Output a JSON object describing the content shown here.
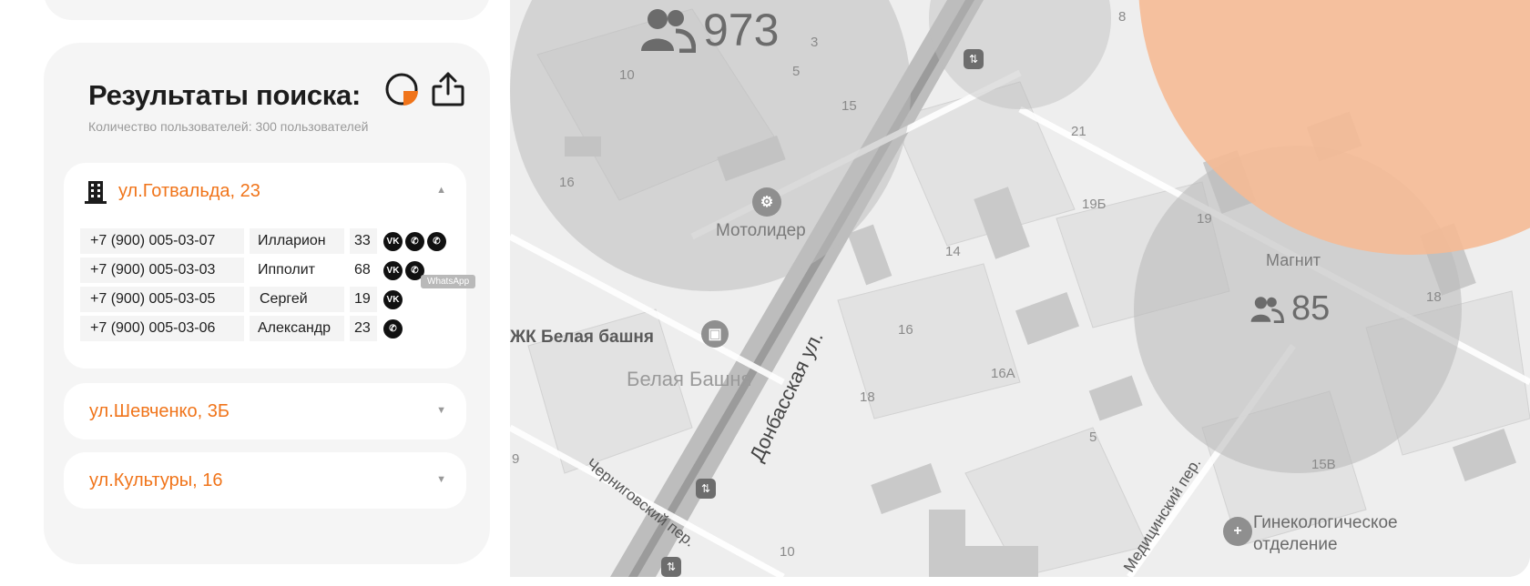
{
  "panel": {
    "title": "Результаты поиска:",
    "users_count": "Количество пользователей: 300 пользователей",
    "pie_icon": "pie-chart-icon",
    "share_icon": "share-icon"
  },
  "addresses": [
    {
      "title": "ул.Готвальда, 23",
      "expanded": true,
      "icon": "building-icon",
      "rows": [
        {
          "phone": "+7 (900) 005-03-07",
          "name": "Илларион",
          "age": "33",
          "socials": [
            "vk",
            "whatsapp",
            "whatsapp"
          ]
        },
        {
          "phone": "+7 (900) 005-03-03",
          "name": "Ипполит",
          "age": "68",
          "socials": [
            "vk",
            "whatsapp"
          ]
        },
        {
          "phone": "+7 (900) 005-03-05",
          "name": "Сергей",
          "age": "19",
          "socials": [
            "vk"
          ]
        },
        {
          "phone": "+7 (900) 005-03-06",
          "name": "Александр",
          "age": "23",
          "socials": [
            "whatsapp"
          ]
        }
      ]
    },
    {
      "title": "ул.Шевченко, 3Б",
      "expanded": false
    },
    {
      "title": "ул.Культуры, 16",
      "expanded": false
    }
  ],
  "tooltip": "WhatsApp",
  "social_labels": {
    "vk": "VK"
  },
  "map": {
    "clusters": [
      {
        "count": "973",
        "color": "#bdbdbd"
      },
      {
        "count": "85",
        "color": "#bdbdbd"
      }
    ],
    "highlight_color": "#f6b993",
    "places": {
      "motolider": "Мотолидер",
      "zhk": "ЖК Белая башня",
      "belaya": "Белая Башня",
      "donbass": "Донбасская ул.",
      "chernigov": "Черниговский пер.",
      "medic": "Медицинский пер.",
      "magnit": "Магнит",
      "gyn1": "Гинекологическое",
      "gyn2": "отделение"
    },
    "numbers": {
      "n3": "3",
      "n5a": "5",
      "n10a": "10",
      "n15": "15",
      "n16a": "16",
      "n21": "21",
      "n19b": "19Б",
      "n19": "19",
      "n14": "14",
      "n16b": "16",
      "n16v": "16А",
      "n18a": "18",
      "n5b": "5",
      "n9": "9",
      "n10b": "10",
      "n15v": "15В",
      "n18b": "18",
      "n8": "8"
    }
  }
}
